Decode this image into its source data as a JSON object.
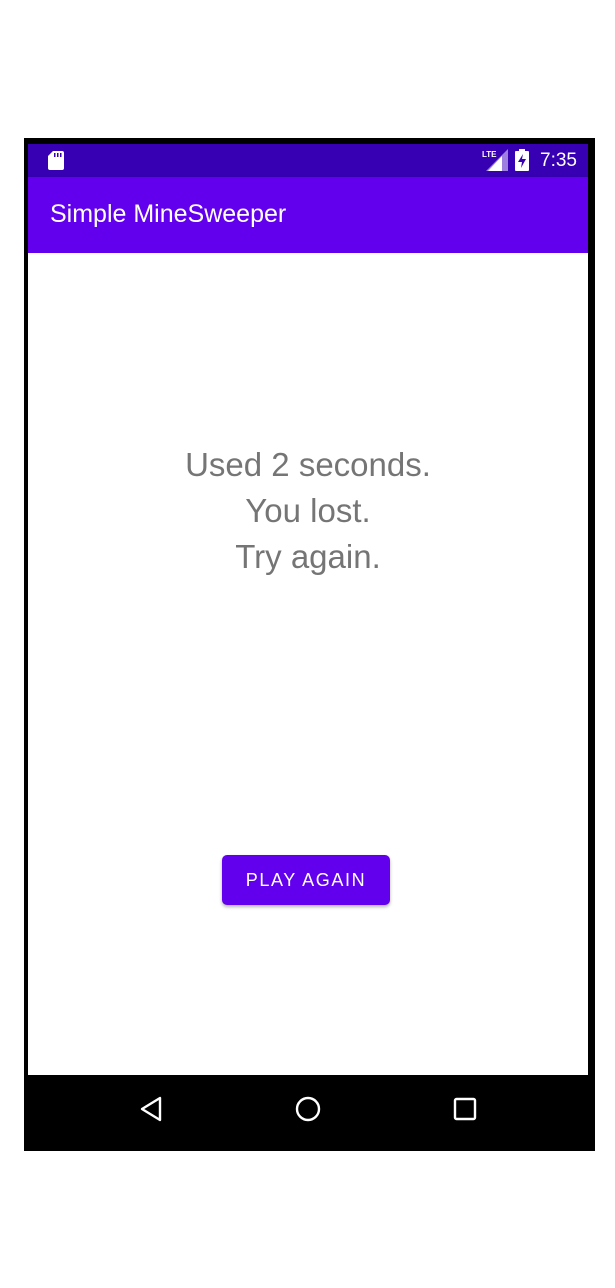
{
  "status_bar": {
    "time": "7:35",
    "icons": [
      "sd-card-icon",
      "lte-signal-icon",
      "battery-charging-icon"
    ],
    "network_label": "LTE"
  },
  "app_bar": {
    "title": "Simple MineSweeper",
    "color": "#6200ee",
    "status_color": "#3700b3"
  },
  "result": {
    "lines": [
      "Used 2 seconds.",
      "You lost.",
      "Try again."
    ],
    "color": "#757575"
  },
  "actions": {
    "play_again_label": "PLAY AGAIN"
  },
  "navigation": {
    "buttons": [
      "back-icon",
      "home-icon",
      "recents-icon"
    ]
  }
}
